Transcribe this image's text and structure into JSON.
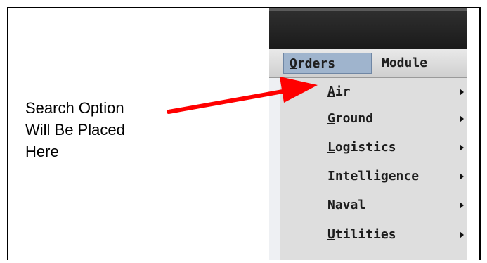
{
  "annotation": {
    "lines": [
      "Search Option",
      "Will Be Placed",
      "Here"
    ]
  },
  "menubar": {
    "items": [
      {
        "label": "Orders",
        "mnemonic": "O",
        "rest": "rders"
      },
      {
        "label": "Module",
        "mnemonic": "M",
        "rest": "odule"
      }
    ]
  },
  "orders_menu": {
    "items": [
      {
        "label": "Air",
        "mnemonic": "A",
        "rest": "ir",
        "submenu_icon": "submenu-arrow-icon"
      },
      {
        "label": "Ground",
        "mnemonic": "G",
        "rest": "round",
        "submenu_icon": "submenu-arrow-icon"
      },
      {
        "label": "Logistics",
        "mnemonic": "L",
        "rest": "ogistics",
        "submenu_icon": "submenu-arrow-icon"
      },
      {
        "label": "Intelligence",
        "mnemonic": "I",
        "rest": "ntelligence",
        "submenu_icon": "submenu-arrow-icon"
      },
      {
        "label": "Naval",
        "mnemonic": "N",
        "rest": "aval",
        "submenu_icon": "submenu-arrow-icon"
      },
      {
        "label": "Utilities",
        "mnemonic": "U",
        "rest": "tilities",
        "submenu_icon": "submenu-arrow-icon"
      }
    ]
  },
  "colors": {
    "pointer_arrow": "#ff0000",
    "selected_menu": "#9fb4cd",
    "titlebar": "#1a1a1a"
  }
}
